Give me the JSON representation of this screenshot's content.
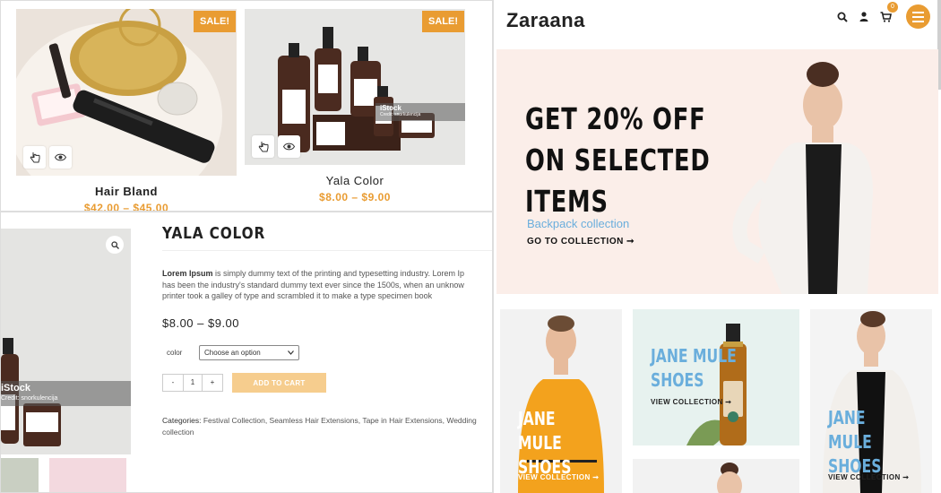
{
  "grid": {
    "products": [
      {
        "name": "Hair Bland",
        "price": "$42.00 – $45.00",
        "badge": "SALE!"
      },
      {
        "name": "Yala Color",
        "price": "$8.00 – $9.00",
        "badge": "SALE!",
        "watermark": "iStock",
        "credit": "Credit: snorkulencija"
      }
    ]
  },
  "detail": {
    "title": "YALA COLOR",
    "description_bold": "Lorem Ipsum",
    "description_line1": " is simply dummy text of the printing and typesetting industry. Lorem Ip",
    "description_line2": "has been the industry's standard dummy text ever since the 1500s, when an unknow",
    "description_line3": "printer took a galley of type and scrambled it to make a type specimen book",
    "price": "$8.00 – $9.00",
    "color_label": "color",
    "color_select": "Choose an option",
    "qty_minus": "-",
    "qty_value": "1",
    "qty_plus": "+",
    "add_to_cart": "ADD TO CART",
    "categories_label": "Categories:",
    "categories": "Festival Collection, Seamless Hair Extensions, Tape in Hair Extensions, Wedding collection",
    "watermark": "iStock",
    "credit": "Credit: snorkulencija"
  },
  "home": {
    "brand": "Zaraana",
    "cart_count": "0",
    "hero": {
      "line1": "GET 20% OFF",
      "line2": "ON SELECTED",
      "line3": "ITEMS",
      "subtitle": "Backpack collection",
      "link": "GO TO COLLECTION ➞"
    },
    "tiles": [
      {
        "title1": "JANE MULE",
        "title2": "SHOES",
        "link": "VIEW COLLECTION ➞"
      },
      {
        "title1": "JANE MULE",
        "title2": "SHOES",
        "link": "VIEW COLLECTION ➞"
      },
      {
        "title1": "JANE MULE",
        "title2": "SHOES",
        "link": "VIEW COLLECTION ➞"
      }
    ]
  },
  "colors": {
    "accent": "#e99c32",
    "hero_bg": "#fbeee9",
    "link_blue": "#6aaedc",
    "add_cart": "#f6cd8e"
  }
}
